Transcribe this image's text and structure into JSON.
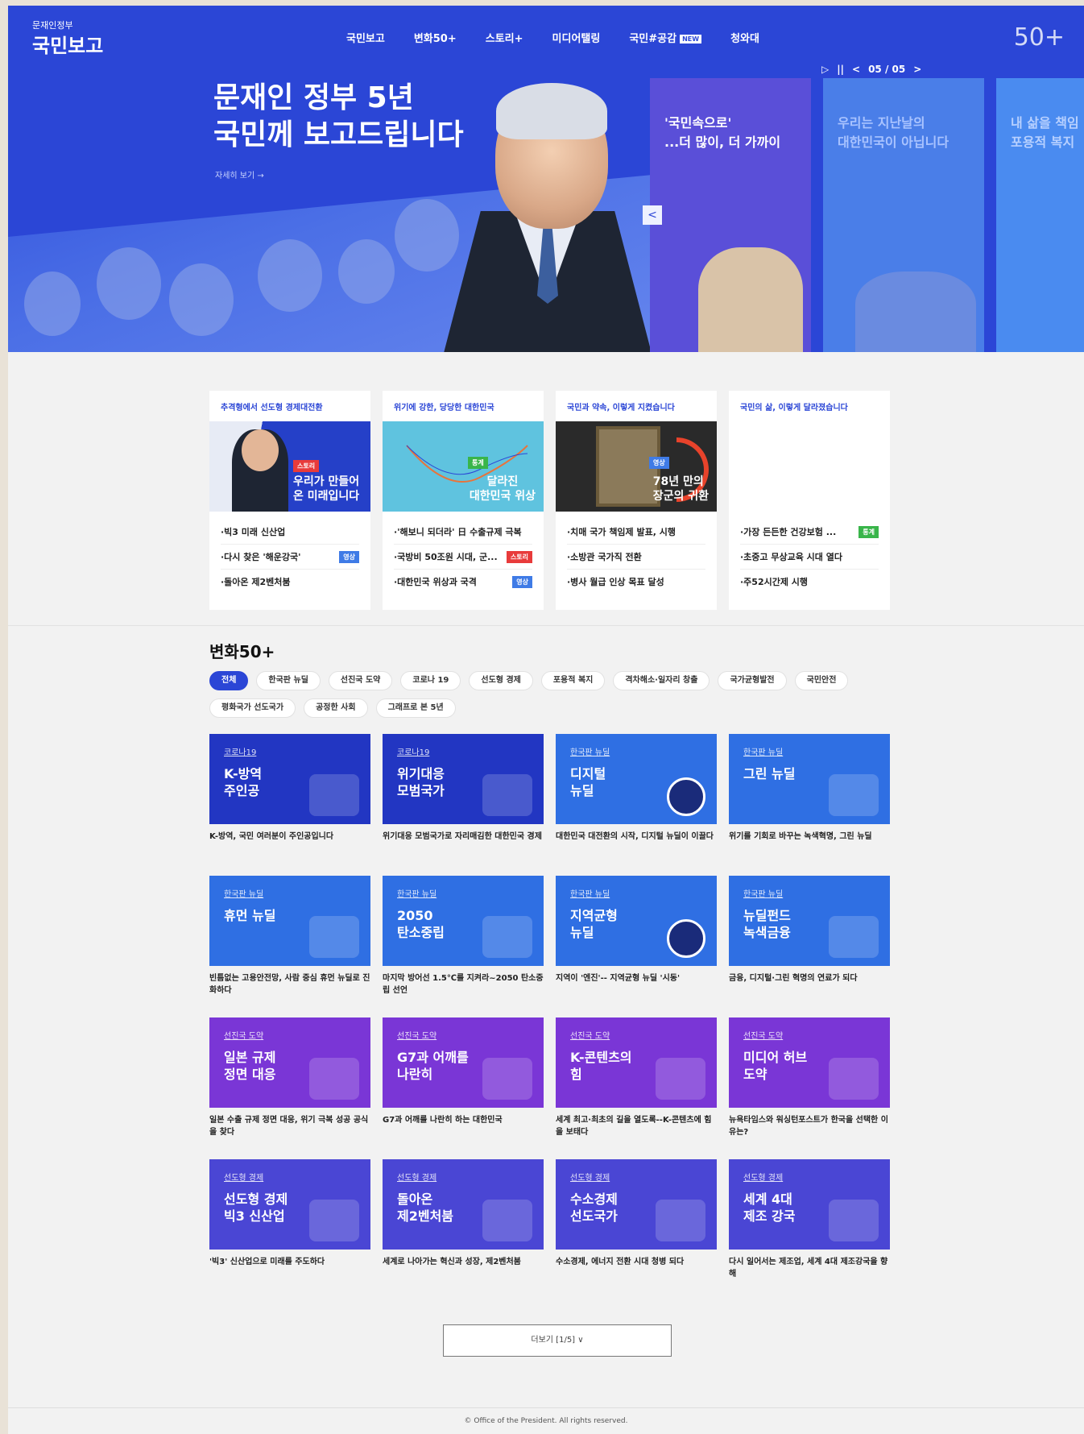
{
  "header": {
    "logo_small": "문재인정부",
    "logo_big": "국민보고",
    "nav": [
      "국민보고",
      "변화50+",
      "스토리+",
      "미디어탤링",
      "국민#공감",
      "청와대"
    ],
    "nav_new_badge": "NEW",
    "anniversary_mark": "50+"
  },
  "hero": {
    "title_line1": "문재인 정부 5년",
    "title_line2": "국민께 보고드립니다",
    "more_link": "자세히 보기 →",
    "pager": {
      "play": "▷",
      "pause": "||",
      "prev": "<",
      "current": "05 / 05",
      "next": ">"
    },
    "prev_arrow": "<",
    "cards": [
      {
        "line1": "'국민속으로'",
        "line2": "...더 많이, 더 가까이"
      },
      {
        "line1": "우리는 지난날의",
        "line2": "대한민국이 아닙니다"
      },
      {
        "line1": "내 삶을 책임",
        "line2": "포용적 복지"
      }
    ]
  },
  "feature_cards": [
    {
      "head": "추격형에서 선도형 경제대전환",
      "img_text": "우리가 만들어\n온 미래입니다",
      "img_badge": "스토리",
      "items": [
        {
          "text": "·빅3 미래 신산업",
          "tag": ""
        },
        {
          "text": "·다시 찾은 '해운강국'",
          "tag": "영상"
        },
        {
          "text": "·돌아온 제2벤처붐",
          "tag": ""
        }
      ]
    },
    {
      "head": "위기에 강한, 당당한 대한민국",
      "img_text": "달라진\n대한민국 위상",
      "img_badge": "통계",
      "items": [
        {
          "text": "·'해보니 되더라' 日 수출규제 극복",
          "tag": ""
        },
        {
          "text": "·국방비 50조원 시대, 군...",
          "tag": "스토리"
        },
        {
          "text": "·대한민국 위상과 국격",
          "tag": "영상"
        }
      ]
    },
    {
      "head": "국민과 약속, 이렇게 지켰습니다",
      "img_text": "78년 만의\n장군의 귀환",
      "img_badge": "영상",
      "items": [
        {
          "text": "·치매 국가 책임제 발표, 시행",
          "tag": ""
        },
        {
          "text": "·소방관 국가직 전환",
          "tag": ""
        },
        {
          "text": "·병사 월급 인상 목표 달성",
          "tag": ""
        }
      ]
    },
    {
      "head": "국민의 삶, 이렇게 달라졌습니다",
      "img_text": "",
      "img_badge": "",
      "items": [
        {
          "text": "·가장 든든한 건강보험 ...",
          "tag": "통계"
        },
        {
          "text": "·초중고 무상교육 시대 열다",
          "tag": ""
        },
        {
          "text": "·주52시간제 시행",
          "tag": ""
        }
      ]
    }
  ],
  "change50": {
    "title": "변화50+",
    "filters": [
      "전체",
      "한국판 뉴딜",
      "선진국 도약",
      "코로나 19",
      "선도형 경제",
      "포용적 복지",
      "격차해소·일자리 창출",
      "국가균형발전",
      "국민안전",
      "평화국가 선도국가",
      "공정한 사회",
      "그래프로 본 5년"
    ],
    "tiles": [
      {
        "cat": "코로나19",
        "title": "K-방역\n주인공",
        "desc": "K-방역, 국민 여러분이 주인공입니다",
        "color": "#2236c2"
      },
      {
        "cat": "코로나19",
        "title": "위기대응\n모범국가",
        "desc": "위기대응 모범국가로 자리매김한 대한민국 경제",
        "color": "#2236c2"
      },
      {
        "cat": "한국판 뉴딜",
        "title": "디지털\n뉴딜",
        "desc": "대한민국 대전환의 시작, 디지털 뉴딜이 이끌다",
        "color": "#2f6fe3"
      },
      {
        "cat": "한국판 뉴딜",
        "title": "그린 뉴딜",
        "desc": "위기를 기회로 바꾸는 녹색혁명, 그린 뉴딜",
        "color": "#2f6fe3"
      },
      {
        "cat": "한국판 뉴딜",
        "title": "휴먼 뉴딜",
        "desc": "빈틈없는 고용안전망, 사람 중심 휴먼 뉴딜로 진화하다",
        "color": "#2f6fe3"
      },
      {
        "cat": "한국판 뉴딜",
        "title": "2050\n탄소중립",
        "desc": "마지막 방어선 1.5℃를 지켜라~2050 탄소중립 선언",
        "color": "#2f6fe3"
      },
      {
        "cat": "한국판 뉴딜",
        "title": "지역균형\n뉴딜",
        "desc": "지역이 '엔진'-- 지역균형 뉴딜 '시동'",
        "color": "#2f6fe3"
      },
      {
        "cat": "한국판 뉴딜",
        "title": "뉴딜펀드\n녹색금융",
        "desc": "금융, 디지털·그린 혁명의 연료가 되다",
        "color": "#2f6fe3"
      },
      {
        "cat": "선진국 도약",
        "title": "일본 규제\n정면 대응",
        "desc": "일본 수출 규제 정면 대응, 위기 극복 성공 공식을 찾다",
        "color": "#7a36d6"
      },
      {
        "cat": "선진국 도약",
        "title": "G7과 어깨를\n나란히",
        "desc": "G7과 어깨를 나란히 하는 대한민국",
        "color": "#7a36d6"
      },
      {
        "cat": "선진국 도약",
        "title": "K-콘텐츠의\n힘",
        "desc": "세계 최고·최초의 길을 열도록--K-콘텐츠에 힘을 보태다",
        "color": "#7a36d6"
      },
      {
        "cat": "선진국 도약",
        "title": "미디어 허브\n도약",
        "desc": "뉴욕타임스와 워싱턴포스트가 한국을 선택한 이유는?",
        "color": "#7a36d6"
      },
      {
        "cat": "선도형 경제",
        "title": "선도형 경제\n빅3 신산업",
        "desc": "'빅3' 신산업으로 미래를 주도하다",
        "color": "#4a46d4"
      },
      {
        "cat": "선도형 경제",
        "title": "돌아온\n제2벤처붐",
        "desc": "세계로 나아가는 혁신과 성장, 제2벤처붐",
        "color": "#4a46d4"
      },
      {
        "cat": "선도형 경제",
        "title": "수소경제\n선도국가",
        "desc": "수소경제, 에너지 전환 시대 청병 되다",
        "color": "#4a46d4"
      },
      {
        "cat": "선도형 경제",
        "title": "세계 4대\n제조 강국",
        "desc": "다시 일어서는 제조업, 세계 4대 제조강국을 향해",
        "color": "#4a46d4"
      }
    ],
    "more_button": "더보기 [1/5] ∨"
  },
  "footer": {
    "copyright": "© Office of the President. All rights reserved."
  },
  "colors": {
    "primary": "#2b46d6",
    "purple": "#7a36d6",
    "light_blue": "#2f6fe3"
  }
}
